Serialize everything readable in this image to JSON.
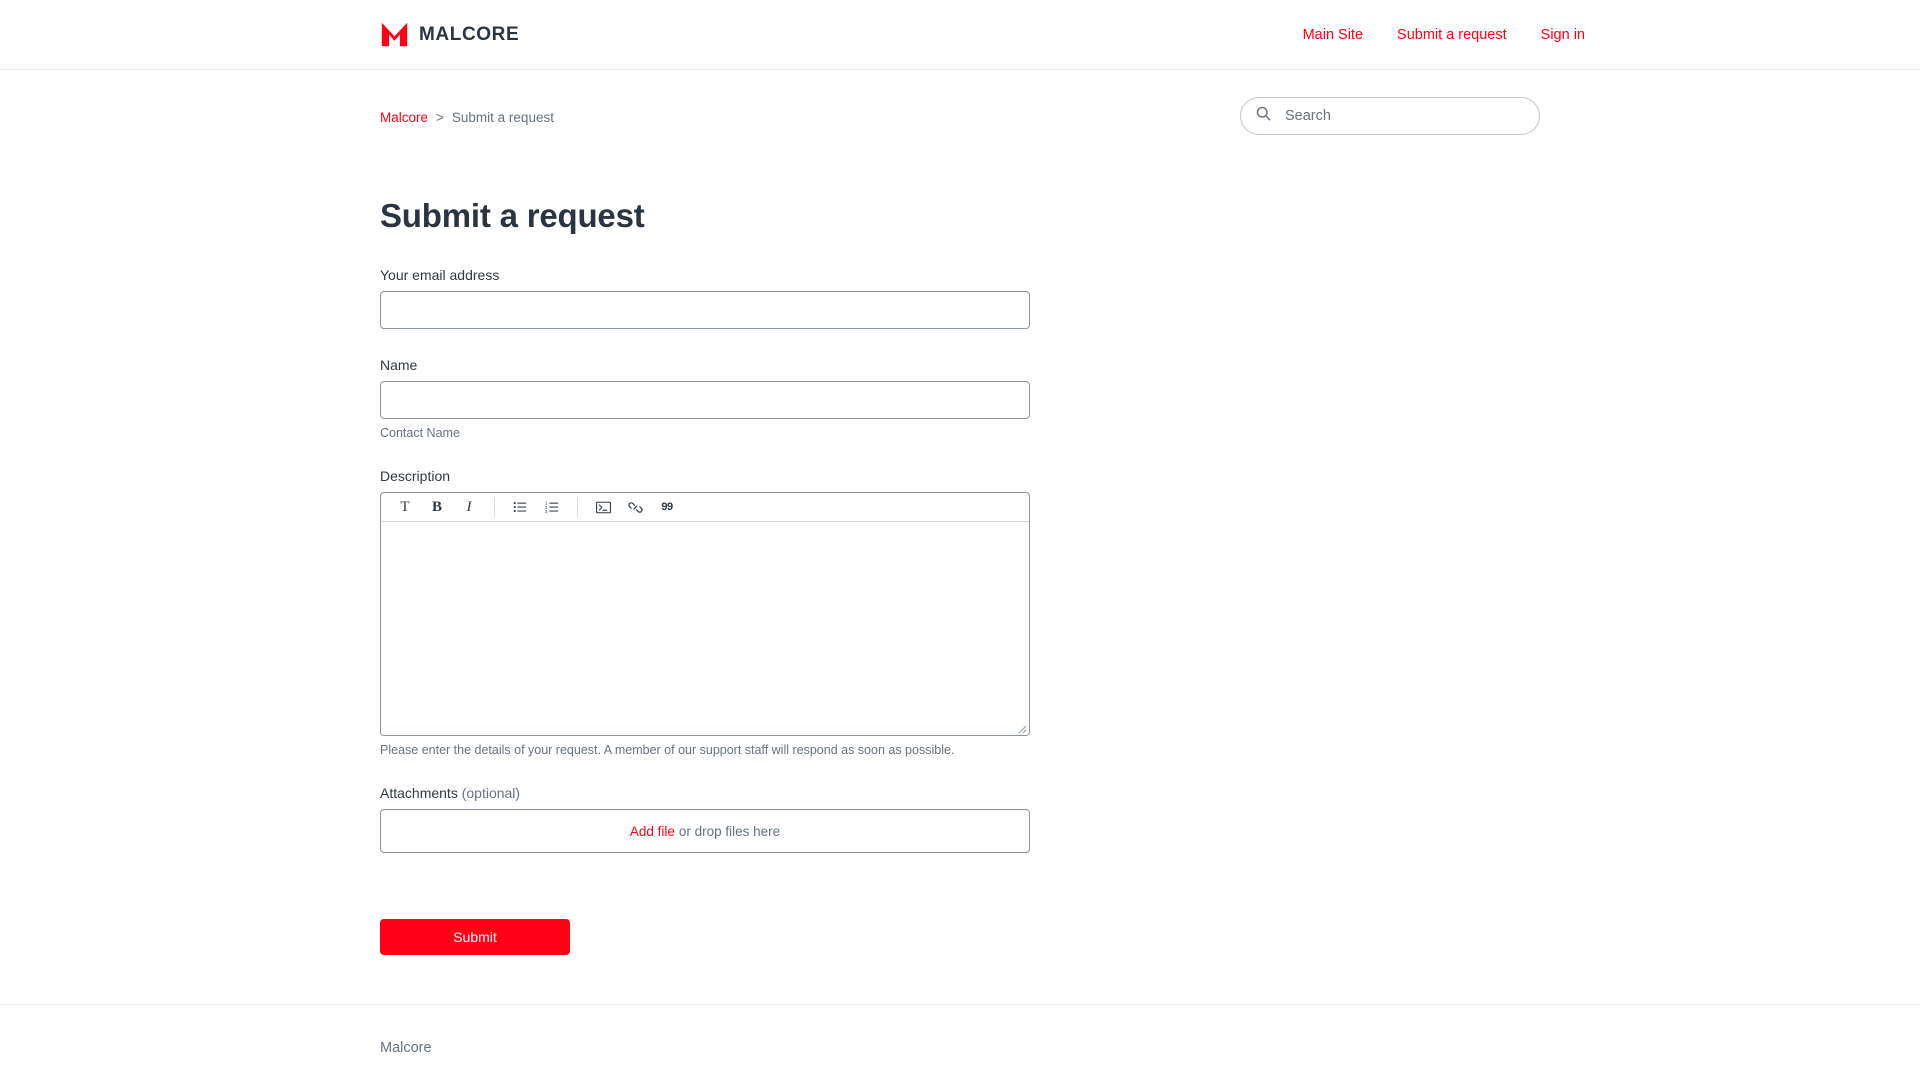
{
  "header": {
    "logo_text": "MALCORE",
    "logo_icon": "malcore-m-logo",
    "nav": [
      {
        "label": "Main Site"
      },
      {
        "label": "Submit a request"
      },
      {
        "label": "Sign in"
      }
    ]
  },
  "breadcrumb": {
    "root": "Malcore",
    "separator": ">",
    "current": "Submit a request"
  },
  "search": {
    "placeholder": "Search",
    "value": "",
    "icon": "search-icon"
  },
  "main": {
    "title": "Submit a request",
    "fields": {
      "email": {
        "label": "Your email address",
        "value": "",
        "placeholder": ""
      },
      "name": {
        "label": "Name",
        "value": "",
        "placeholder": "",
        "hint": "Contact Name"
      },
      "description": {
        "label": "Description",
        "value": "",
        "hint": "Please enter the details of your request. A member of our support staff will respond as soon as possible.",
        "toolbar": [
          {
            "name": "text-style-icon",
            "glyph": "T"
          },
          {
            "name": "bold-icon",
            "glyph": "B"
          },
          {
            "name": "italic-icon",
            "glyph": "I"
          },
          {
            "name": "bulleted-list-icon",
            "glyph": ""
          },
          {
            "name": "numbered-list-icon",
            "glyph": ""
          },
          {
            "name": "code-block-icon",
            "glyph": ""
          },
          {
            "name": "link-icon",
            "glyph": ""
          },
          {
            "name": "blockquote-icon",
            "glyph": "99"
          }
        ]
      },
      "attachments": {
        "label": "Attachments",
        "optional_text": "(optional)",
        "add_file_label": "Add file",
        "drop_text": "or drop files here"
      }
    },
    "submit_label": "Submit"
  },
  "footer": {
    "link_label": "Malcore"
  },
  "colors": {
    "brand_red": "#ff0015",
    "heading": "#2b3441",
    "muted": "#68737d",
    "border": "#8c96a0"
  }
}
